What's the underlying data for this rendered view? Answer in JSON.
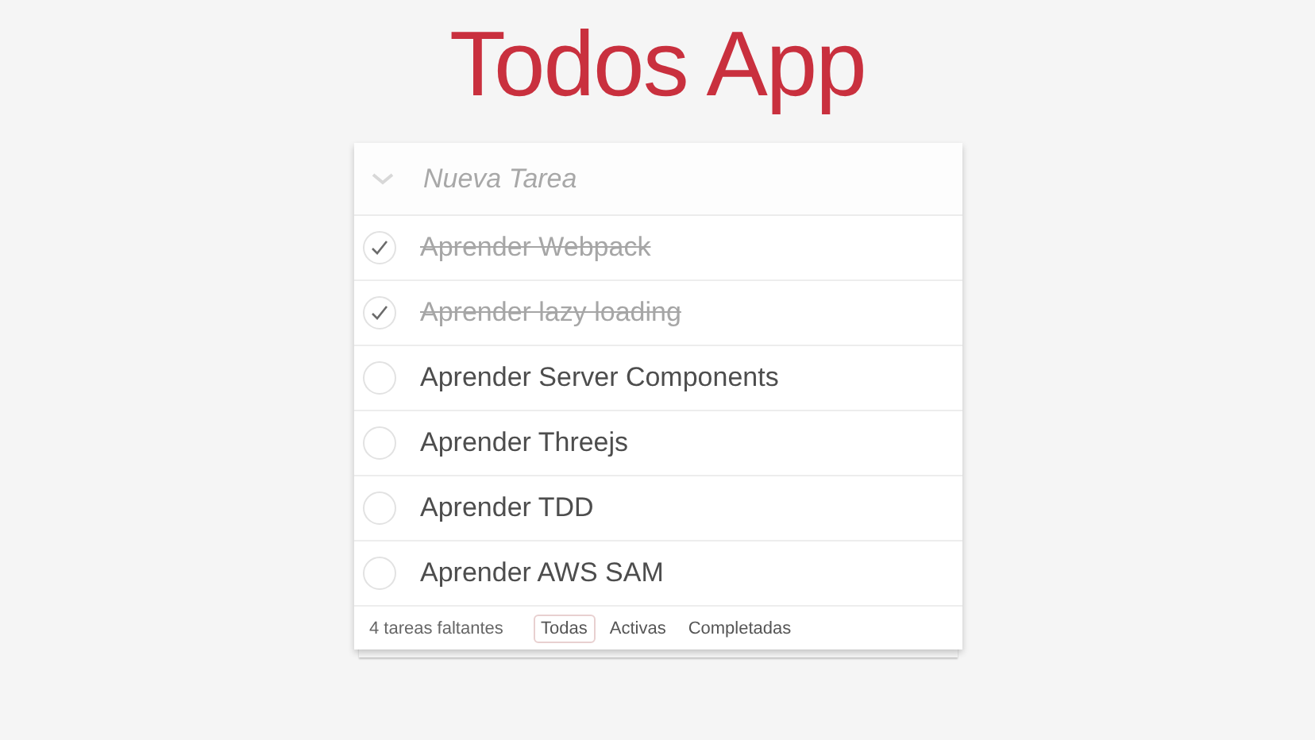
{
  "title": "Todos App",
  "new_todo": {
    "placeholder": "Nueva Tarea"
  },
  "todos": [
    {
      "label": "Aprender Webpack",
      "completed": true
    },
    {
      "label": "Aprender lazy loading",
      "completed": true
    },
    {
      "label": "Aprender Server Components",
      "completed": false
    },
    {
      "label": "Aprender Threejs",
      "completed": false
    },
    {
      "label": "Aprender TDD",
      "completed": false
    },
    {
      "label": "Aprender AWS SAM",
      "completed": false
    }
  ],
  "footer": {
    "count": "4 tareas faltantes",
    "filters": [
      {
        "label": "Todas",
        "selected": true
      },
      {
        "label": "Activas",
        "selected": false
      },
      {
        "label": "Completadas",
        "selected": false
      }
    ]
  }
}
